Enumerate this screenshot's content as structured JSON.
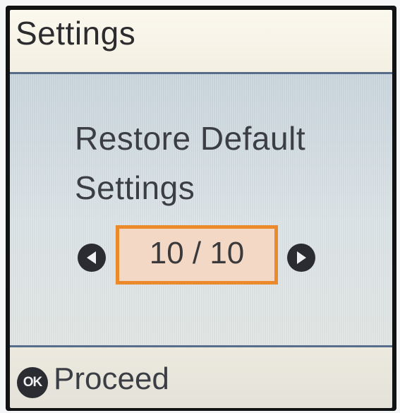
{
  "header": {
    "title": "Settings"
  },
  "message": {
    "line1": "Restore Default",
    "line2": "Settings"
  },
  "pager": {
    "current": 10,
    "total": 10,
    "label": "10 / 10",
    "prev_icon": "left-arrow-icon",
    "next_icon": "right-arrow-icon"
  },
  "footer": {
    "ok_icon_text": "OK",
    "action_label": "Proceed"
  },
  "colors": {
    "highlight_border": "#ea8a2a",
    "highlight_fill": "#f3d9c5",
    "header_bg": "#f6f3e8",
    "content_bg": "#d6e0e4",
    "divider": "#586c8c"
  }
}
